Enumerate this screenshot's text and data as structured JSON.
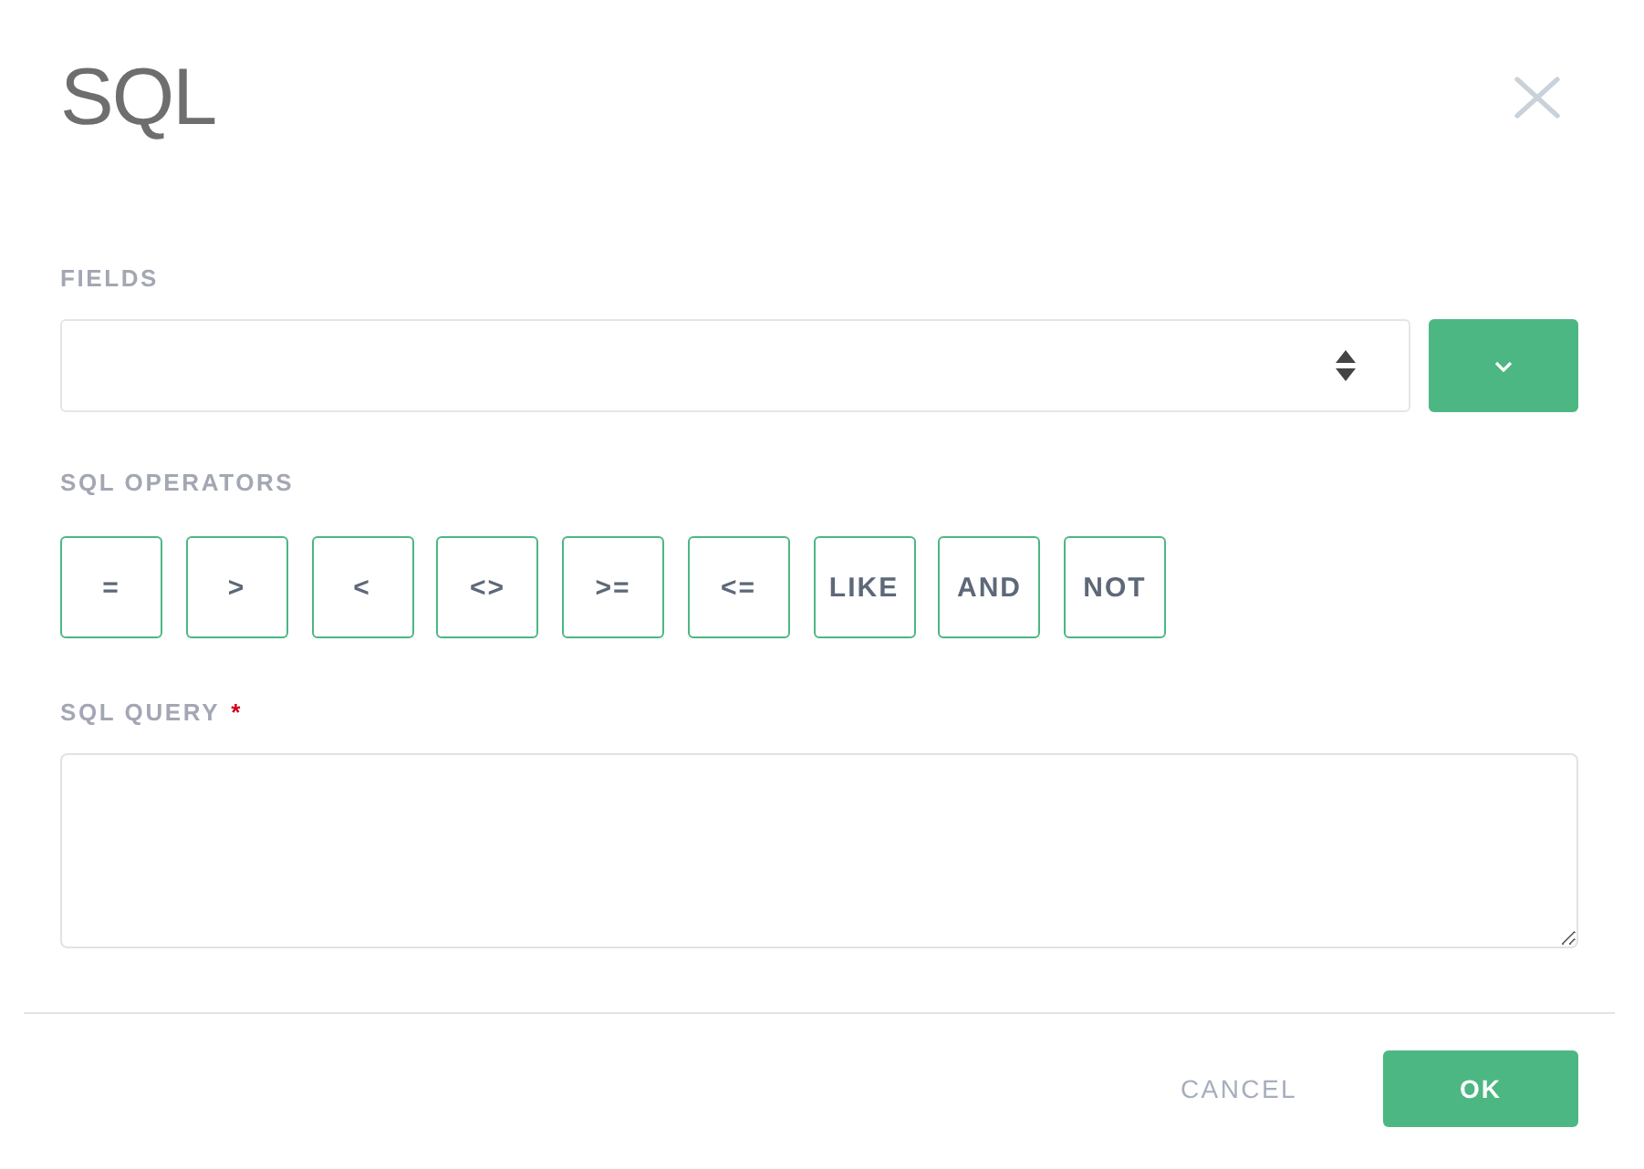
{
  "dialog": {
    "title": "SQL"
  },
  "fields": {
    "label": "FIELDS"
  },
  "operators": {
    "label": "SQL OPERATORS",
    "items": [
      "=",
      ">",
      "<",
      "<>",
      ">=",
      "<=",
      "LIKE",
      "AND",
      "NOT"
    ]
  },
  "query": {
    "label": "SQL QUERY",
    "required_mark": "*"
  },
  "buttons": [
    {
      "label": "CANCEL",
      "kind": "secondary"
    },
    {
      "label": "OK",
      "kind": "primary"
    }
  ]
}
